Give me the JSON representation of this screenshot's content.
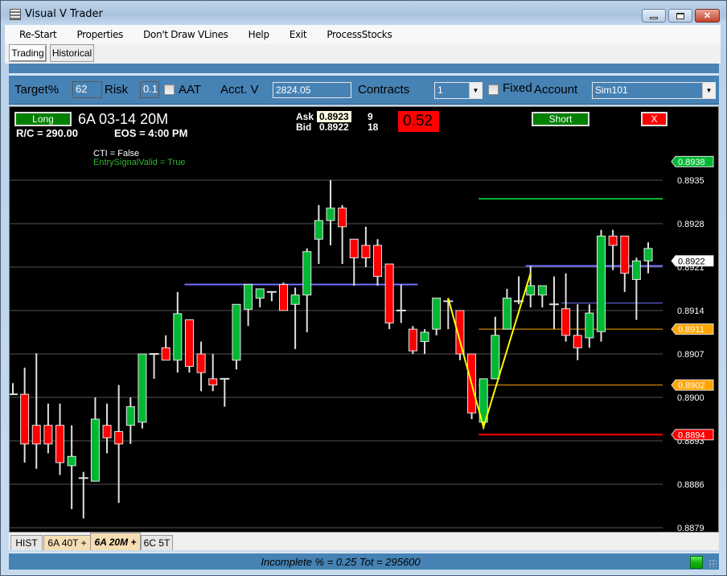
{
  "window": {
    "title": "Visual V Trader",
    "controls": {
      "minimize": "minimize-icon",
      "maximize": "maximize-icon",
      "close": "close-icon"
    }
  },
  "menu": [
    "Re-Start",
    "Properties",
    "Don't Draw VLines",
    "Help",
    "Exit",
    "ProcessStocks"
  ],
  "mode_buttons": {
    "trading": "Trading",
    "historical": "Historical",
    "active": "Trading"
  },
  "controls": {
    "target_label": "Target%",
    "target_value": "62",
    "risk_label": "Risk",
    "risk_value": "0.1",
    "aat_label": "AAT",
    "aat_checked": false,
    "acct_label": "Acct. V",
    "acct_value": "2824.05",
    "contracts_label": "Contracts",
    "contracts_value": "1",
    "fixed_label": "Fixed",
    "fixed_checked": false,
    "account_label": "Account",
    "account_value": "Sim101"
  },
  "chart_header": {
    "long_button": "Long",
    "short_button": "Short",
    "close_button": "X",
    "instrument": "6A 03-14 20M",
    "rc": "R/C = 290.00",
    "eos": "EOS = 4:00 PM",
    "ask_label": "Ask",
    "ask_price": "0.8923",
    "ask_size": "9",
    "bid_label": "Bid",
    "bid_price": "0.8922",
    "bid_size": "18",
    "pl_value": "0.52",
    "cti": "CTI = False",
    "entry_signal": "EntrySignalValid = True"
  },
  "tabs": [
    {
      "label": "HIST",
      "style": "plain"
    },
    {
      "label": "6A 40T +",
      "style": "beige"
    },
    {
      "label": "6A 20M +",
      "style": "active"
    },
    {
      "label": "6C 5T",
      "style": "plain"
    }
  ],
  "status": {
    "text": "Incomplete % = 0.25 Tot = 295600",
    "led": "green"
  },
  "colors": {
    "up": "#00b833",
    "down": "#ff0000",
    "wick": "#e0e0e0",
    "grid": "#555555",
    "target_line": "#00b833",
    "stop_line": "#ff0000",
    "entry_line": "#ffa500",
    "resistance_line": "#7070ff",
    "pattern_line": "#ffff00",
    "accent_blue": "#4682b4"
  },
  "chart_data": {
    "type": "candlestick",
    "title": "6A 03-14 20M",
    "ylim": [
      0.8877,
      0.89415
    ],
    "yticks": [
      "0.8935",
      "0.8928",
      "0.8921",
      "0.8914",
      "0.8907",
      "0.8900",
      "0.8893",
      "0.8886",
      "0.8879"
    ],
    "grid": true,
    "price_markers": [
      {
        "label": "0.8938",
        "value": 0.8938,
        "color": "#00b833",
        "text_color": "#ffffff"
      },
      {
        "label": "0.8922",
        "value": 0.8922,
        "color": "#ffffff",
        "text_color": "#000000"
      },
      {
        "label": "0.8911",
        "value": 0.8911,
        "color": "#ffa500",
        "text_color": "#ffffff"
      },
      {
        "label": "0.8902",
        "value": 0.8902,
        "color": "#ffa500",
        "text_color": "#ffffff"
      },
      {
        "label": "0.8894",
        "value": 0.8894,
        "color": "#ff0000",
        "text_color": "#ffffff"
      }
    ],
    "hlines": [
      {
        "name": "target-line",
        "value": 0.8932,
        "from_bar": 40,
        "color": "#00b833",
        "width": 2
      },
      {
        "name": "resistance-line-1",
        "value": 0.89182,
        "from_bar": 15,
        "to_bar": 34,
        "color": "#7070ff",
        "width": 2
      },
      {
        "name": "resistance-line-2",
        "value": 0.89212,
        "from_bar": 44,
        "color": "#7070ff",
        "width": 2
      },
      {
        "name": "resistance-line-3",
        "value": 0.89152,
        "from_bar": 47,
        "color": "#7070ff",
        "width": 1
      },
      {
        "name": "entry-line-1",
        "value": 0.8911,
        "from_bar": 40,
        "color": "#ffa500",
        "width": 1
      },
      {
        "name": "entry-line-2",
        "value": 0.8902,
        "from_bar": 40,
        "color": "#ffa500",
        "width": 1
      },
      {
        "name": "stop-line",
        "value": 0.8894,
        "from_bar": 40,
        "color": "#ff0000",
        "width": 2
      }
    ],
    "pattern": [
      {
        "bar": 37,
        "value": 0.8916
      },
      {
        "bar": 40,
        "value": 0.88952
      },
      {
        "bar": 44,
        "value": 0.892
      }
    ],
    "candles": [
      {
        "o": 0.89005,
        "h": 0.89023,
        "l": 0.89005,
        "c": 0.89005
      },
      {
        "o": 0.89005,
        "h": 0.89048,
        "l": 0.88895,
        "c": 0.88925
      },
      {
        "o": 0.88955,
        "h": 0.89071,
        "l": 0.88885,
        "c": 0.88925
      },
      {
        "o": 0.88955,
        "h": 0.8899,
        "l": 0.8891,
        "c": 0.88925
      },
      {
        "o": 0.88955,
        "h": 0.8899,
        "l": 0.88875,
        "c": 0.88895
      },
      {
        "o": 0.8889,
        "h": 0.88955,
        "l": 0.8882,
        "c": 0.88905
      },
      {
        "o": 0.8887,
        "h": 0.8888,
        "l": 0.88805,
        "c": 0.8887
      },
      {
        "o": 0.88865,
        "h": 0.89,
        "l": 0.88865,
        "c": 0.88965
      },
      {
        "o": 0.88955,
        "h": 0.8899,
        "l": 0.8891,
        "c": 0.88935
      },
      {
        "o": 0.88945,
        "h": 0.8902,
        "l": 0.8883,
        "c": 0.88925
      },
      {
        "o": 0.88955,
        "h": 0.89,
        "l": 0.88925,
        "c": 0.88985
      },
      {
        "o": 0.8896,
        "h": 0.8907,
        "l": 0.8895,
        "c": 0.8907
      },
      {
        "o": 0.8907,
        "h": 0.8907,
        "l": 0.8903,
        "c": 0.8907
      },
      {
        "o": 0.8908,
        "h": 0.891,
        "l": 0.8906,
        "c": 0.8906
      },
      {
        "o": 0.8906,
        "h": 0.8917,
        "l": 0.8904,
        "c": 0.89135
      },
      {
        "o": 0.89125,
        "h": 0.89125,
        "l": 0.8904,
        "c": 0.8905
      },
      {
        "o": 0.8907,
        "h": 0.8909,
        "l": 0.8901,
        "c": 0.8904
      },
      {
        "o": 0.8903,
        "h": 0.8907,
        "l": 0.8901,
        "c": 0.8902
      },
      {
        "o": 0.8903,
        "h": 0.8903,
        "l": 0.88985,
        "c": 0.8903
      },
      {
        "o": 0.8906,
        "h": 0.8915,
        "l": 0.89045,
        "c": 0.8915
      },
      {
        "o": 0.89142,
        "h": 0.8918,
        "l": 0.89115,
        "c": 0.89182
      },
      {
        "o": 0.8916,
        "h": 0.8917,
        "l": 0.89145,
        "c": 0.89175
      },
      {
        "o": 0.8917,
        "h": 0.8917,
        "l": 0.89155,
        "c": 0.8917
      },
      {
        "o": 0.89182,
        "h": 0.89185,
        "l": 0.8914,
        "c": 0.8914
      },
      {
        "o": 0.8915,
        "h": 0.89177,
        "l": 0.89078,
        "c": 0.89165
      },
      {
        "o": 0.89165,
        "h": 0.8924,
        "l": 0.89105,
        "c": 0.89235
      },
      {
        "o": 0.89255,
        "h": 0.8931,
        "l": 0.89215,
        "c": 0.89285
      },
      {
        "o": 0.89285,
        "h": 0.8935,
        "l": 0.89245,
        "c": 0.89305
      },
      {
        "o": 0.89305,
        "h": 0.8931,
        "l": 0.89215,
        "c": 0.89275
      },
      {
        "o": 0.89255,
        "h": 0.89255,
        "l": 0.8918,
        "c": 0.89225
      },
      {
        "o": 0.89245,
        "h": 0.89275,
        "l": 0.8921,
        "c": 0.89225
      },
      {
        "o": 0.89245,
        "h": 0.89255,
        "l": 0.8918,
        "c": 0.89195
      },
      {
        "o": 0.89215,
        "h": 0.89215,
        "l": 0.8911,
        "c": 0.8912
      },
      {
        "o": 0.8914,
        "h": 0.89182,
        "l": 0.8912,
        "c": 0.8914
      },
      {
        "o": 0.8911,
        "h": 0.89115,
        "l": 0.8907,
        "c": 0.89075
      },
      {
        "o": 0.8909,
        "h": 0.8911,
        "l": 0.8907,
        "c": 0.89105
      },
      {
        "o": 0.8911,
        "h": 0.8916,
        "l": 0.891,
        "c": 0.8916
      },
      {
        "o": 0.89155,
        "h": 0.8916,
        "l": 0.8911,
        "c": 0.89155
      },
      {
        "o": 0.8914,
        "h": 0.8914,
        "l": 0.8906,
        "c": 0.8907
      },
      {
        "o": 0.8907,
        "h": 0.8907,
        "l": 0.88965,
        "c": 0.88975
      },
      {
        "o": 0.8896,
        "h": 0.8903,
        "l": 0.8895,
        "c": 0.8903
      },
      {
        "o": 0.8903,
        "h": 0.8913,
        "l": 0.8903,
        "c": 0.891
      },
      {
        "o": 0.8911,
        "h": 0.89175,
        "l": 0.8911,
        "c": 0.8916
      },
      {
        "o": 0.89155,
        "h": 0.89195,
        "l": 0.8915,
        "c": 0.89155
      },
      {
        "o": 0.89165,
        "h": 0.89212,
        "l": 0.89145,
        "c": 0.8918
      },
      {
        "o": 0.89165,
        "h": 0.8918,
        "l": 0.89145,
        "c": 0.8918
      },
      {
        "o": 0.8915,
        "h": 0.89195,
        "l": 0.8911,
        "c": 0.8915
      },
      {
        "o": 0.89143,
        "h": 0.892,
        "l": 0.8909,
        "c": 0.891
      },
      {
        "o": 0.891,
        "h": 0.8915,
        "l": 0.8906,
        "c": 0.8908
      },
      {
        "o": 0.89096,
        "h": 0.8915,
        "l": 0.8908,
        "c": 0.89136
      },
      {
        "o": 0.89106,
        "h": 0.8927,
        "l": 0.8909,
        "c": 0.8926
      },
      {
        "o": 0.8926,
        "h": 0.8927,
        "l": 0.89205,
        "c": 0.89245
      },
      {
        "o": 0.8926,
        "h": 0.8926,
        "l": 0.8917,
        "c": 0.892
      },
      {
        "o": 0.8919,
        "h": 0.89225,
        "l": 0.89125,
        "c": 0.8922
      },
      {
        "o": 0.8922,
        "h": 0.8925,
        "l": 0.892,
        "c": 0.8924
      }
    ]
  }
}
